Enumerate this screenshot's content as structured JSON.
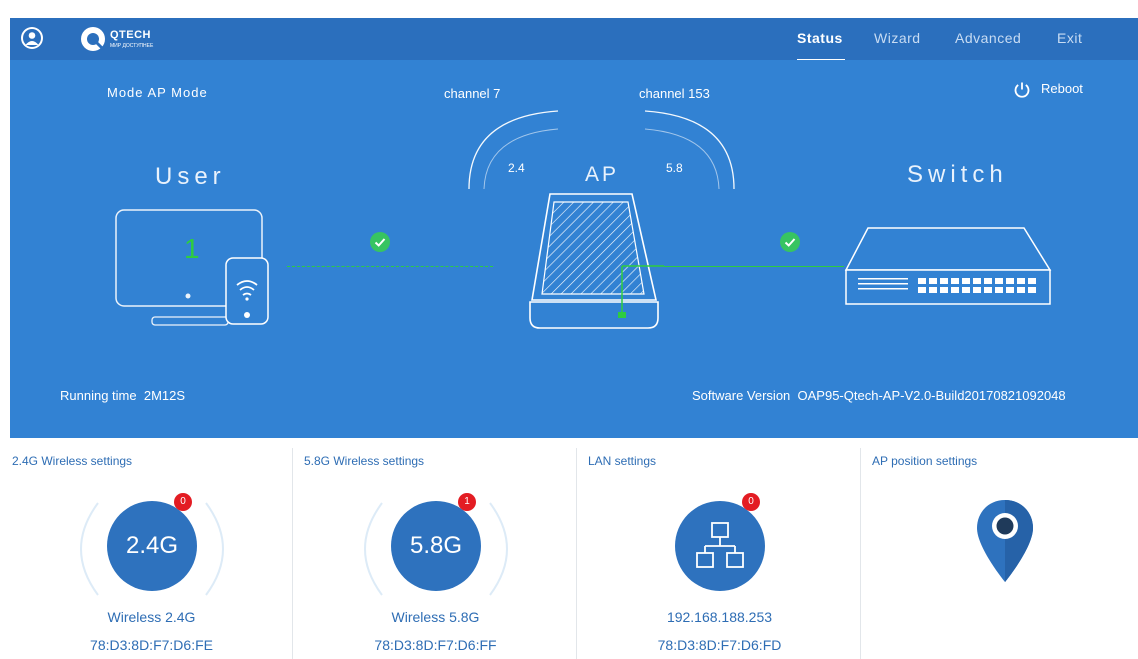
{
  "header": {
    "brand_name": "QTECH",
    "brand_tagline": "МИР ДОСТУПНЕЕ",
    "nav": [
      {
        "label": "Status",
        "active": true
      },
      {
        "label": "Wizard",
        "active": false
      },
      {
        "label": "Advanced",
        "active": false
      },
      {
        "label": "Exit",
        "active": false
      }
    ]
  },
  "status": {
    "mode_label": "Mode",
    "mode_value": "AP Mode",
    "channel_24": "channel 7",
    "channel_58": "channel 153",
    "band_24": "2.4",
    "band_58": "5.8",
    "ap_label": "AP",
    "user_label": "User",
    "switch_label": "Switch",
    "user_count": "1",
    "reboot_label": "Reboot",
    "running_time_label": "Running time",
    "running_time_value": "2M12S",
    "software_version_label": "Software Version",
    "software_version_value": "OAP95-Qtech-AP-V2.0-Build20170821092048"
  },
  "cards": [
    {
      "title": "2.4G Wireless settings",
      "icon_text": "2.4G",
      "badge": "0",
      "line1": "Wireless 2.4G",
      "line2": "78:D3:8D:F7:D6:FE"
    },
    {
      "title": "5.8G Wireless settings",
      "icon_text": "5.8G",
      "badge": "1",
      "line1": "Wireless 5.8G",
      "line2": "78:D3:8D:F7:D6:FF"
    },
    {
      "title": "LAN settings",
      "badge": "0",
      "line1": "192.168.188.253",
      "line2": "78:D3:8D:F7:D6:FD"
    },
    {
      "title": "AP position settings"
    }
  ],
  "colors": {
    "topbar": "#2b6fbd",
    "hero_bg": "#3282d3",
    "accent_green": "#2ecc40",
    "badge_red": "#e31c23",
    "card_text": "#2e6db4"
  }
}
